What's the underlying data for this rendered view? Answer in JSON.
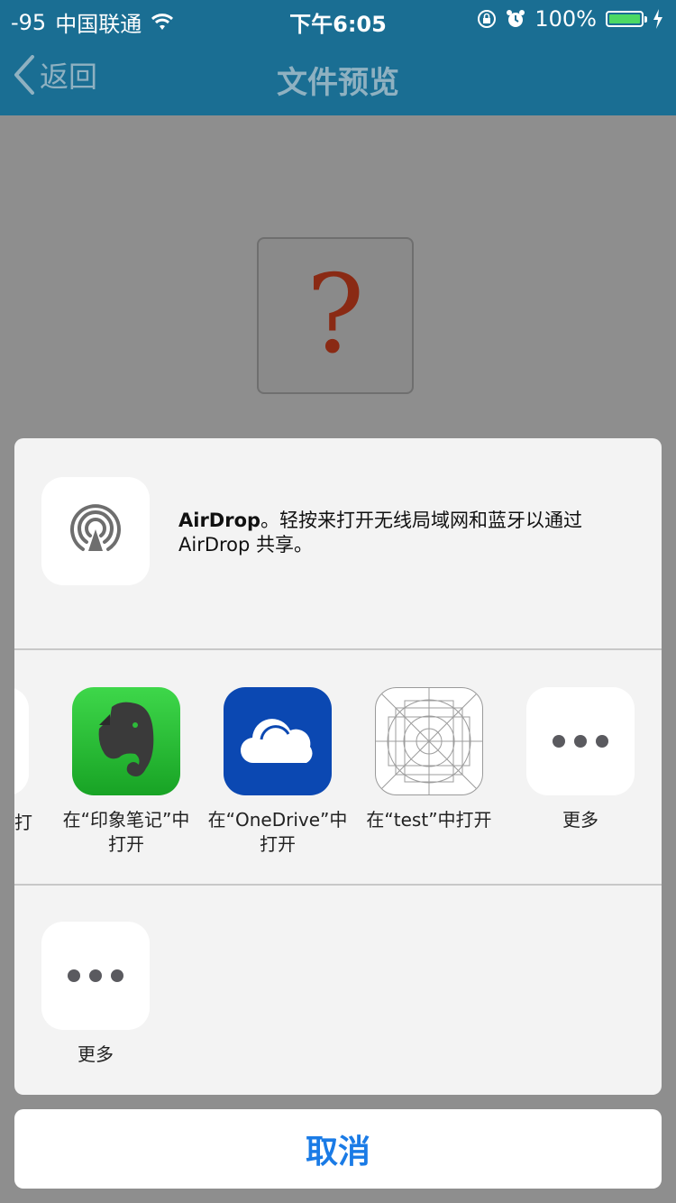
{
  "status": {
    "signal": "-95",
    "carrier": "中国联通",
    "time": "下午6:05",
    "battery": "100%"
  },
  "nav": {
    "back_label": "返回",
    "title": "文件预览"
  },
  "preview": {
    "placeholder_glyph": "?"
  },
  "share": {
    "airdrop": {
      "title": "AirDrop",
      "description": "。轻按来打开无线局域网和蓝牙以通过 AirDrop 共享。"
    },
    "partial_app_label": "打",
    "apps": [
      {
        "label": "在“印象笔记”中打开",
        "icon": "evernote-icon"
      },
      {
        "label": "在“OneDrive”中打开",
        "icon": "onedrive-icon"
      },
      {
        "label": "在“test”中打开",
        "icon": "app-placeholder-icon"
      },
      {
        "label": "更多",
        "icon": "more-icon"
      }
    ],
    "actions": [
      {
        "label": "更多",
        "icon": "more-icon"
      }
    ],
    "cancel_label": "取消"
  },
  "colors": {
    "nav_bg": "#1a6e93",
    "accent": "#1a7be6",
    "evernote_green": "#2dbb39",
    "onedrive_blue": "#0b48b2",
    "battery_green": "#4cd964"
  }
}
